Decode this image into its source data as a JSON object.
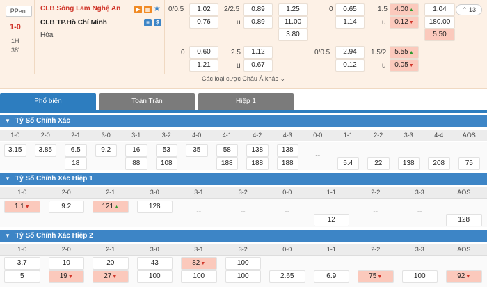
{
  "match": {
    "status_badge": "PPen.",
    "score": "1-0",
    "half": "1H",
    "minute": "38'",
    "home_team": "CLB Sông Lam Nghệ An",
    "away_team": "CLB TP.Hồ Chí Minh",
    "draw_label": "Hòa",
    "collapse_count": "13",
    "more_label": "Các loại cược Châu Á khác"
  },
  "odds": {
    "ft_hdp_line1": "0/0.5",
    "ft_hdp_home1": "1.02",
    "ft_hdp_away1": "0.76",
    "ft_ou_line1": "2/2.5",
    "ft_ou_over1": "0.89",
    "ft_ou_u1": "u",
    "ft_ou_under1": "0.89",
    "ft_1x2_home": "1.25",
    "ft_1x2_away": "11.00",
    "ft_1x2_draw": "3.80",
    "ft_hdp_line2": "0",
    "ft_hdp_home2": "0.60",
    "ft_hdp_away2": "1.21",
    "ft_ou_line2": "2.5",
    "ft_ou_over2": "1.12",
    "ft_ou_u2": "u",
    "ft_ou_under2": "0.67",
    "h1_hdp_line1": "0",
    "h1_hdp_home1": "0.65",
    "h1_hdp_away1": "1.14",
    "h1_ou_line1": "1.5",
    "h1_ou_over1": "4.00",
    "h1_ou_u1": "u",
    "h1_ou_under1": "0.12",
    "h1_1x2_home": "1.04",
    "h1_1x2_away": "180.00",
    "h1_1x2_draw": "5.50",
    "h1_hdp_line2": "0/0.5",
    "h1_hdp_home2": "2.94",
    "h1_hdp_away2": "0.12",
    "h1_ou_line2": "1.5/2",
    "h1_ou_over2": "5.55",
    "h1_ou_u2": "u",
    "h1_ou_under2": "0.05"
  },
  "tabs": [
    "Phổ biến",
    "Toàn Trận",
    "Hiệp 1"
  ],
  "sections": {
    "ft": {
      "title": "Tỷ Số Chính Xác",
      "headers": [
        "1-0",
        "2-0",
        "2-1",
        "3-0",
        "3-1",
        "3-2",
        "4-0",
        "4-1",
        "4-2",
        "4-3",
        "0-0",
        "1-1",
        "2-2",
        "3-3",
        "4-4",
        "AOS"
      ],
      "row1": [
        "3.15",
        "3.85",
        "6.5",
        "9.2",
        "16",
        "53",
        "35",
        "58",
        "138",
        "138",
        "",
        "",
        "",
        "",
        "",
        ""
      ],
      "row2": [
        "",
        "",
        "18",
        "",
        "88",
        "108",
        "",
        "188",
        "188",
        "188",
        "--",
        "5.4",
        "22",
        "138",
        "208",
        "75"
      ]
    },
    "h1": {
      "title": "Tỷ Số Chính Xác Hiệp 1",
      "headers": [
        "1-0",
        "2-0",
        "2-1",
        "3-0",
        "3-1",
        "3-2",
        "0-0",
        "1-1",
        "2-2",
        "3-3",
        "AOS"
      ],
      "row1": [
        "1.1",
        "9.2",
        "121",
        "128",
        "",
        "",
        "",
        "",
        "",
        "",
        ""
      ],
      "row2": [
        "",
        "",
        "",
        "",
        "--",
        "--",
        "--",
        "12",
        "--",
        "--",
        "128"
      ]
    },
    "h2": {
      "title": "Tỷ Số Chính Xác Hiệp 2",
      "headers": [
        "1-0",
        "2-0",
        "2-1",
        "3-0",
        "3-1",
        "3-2",
        "0-0",
        "1-1",
        "2-2",
        "3-3",
        "AOS"
      ],
      "row1": [
        "3.7",
        "10",
        "20",
        "43",
        "82",
        "100",
        "",
        "",
        "",
        "",
        ""
      ],
      "row2": [
        "5",
        "19",
        "27",
        "100",
        "100",
        "100",
        "2.65",
        "6.9",
        "75",
        "100",
        "92"
      ]
    }
  },
  "colors": {
    "section_blue": "#3d85c6",
    "highlight": "#fbc9bc",
    "up": "#2e9a2e",
    "down": "#d0362a"
  }
}
